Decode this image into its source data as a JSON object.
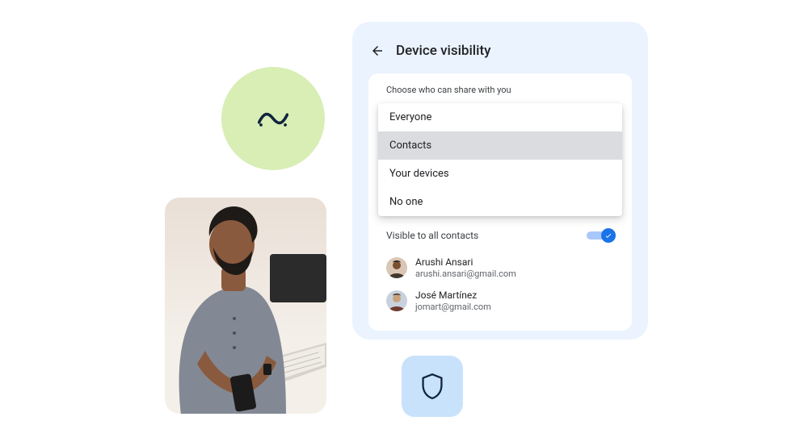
{
  "decor": {
    "wave_icon": "wave-icon",
    "shield_icon": "shield-icon",
    "photo_alt": "person-using-phone"
  },
  "card": {
    "title": "Device visibility",
    "sublabel": "Choose who can share with you",
    "options": [
      {
        "label": "Everyone",
        "selected": false
      },
      {
        "label": "Contacts",
        "selected": true
      },
      {
        "label": "Your devices",
        "selected": false
      },
      {
        "label": "No one",
        "selected": false
      }
    ],
    "visible_row_label": "Visible to all contacts",
    "toggle_on": true,
    "contacts": [
      {
        "name": "Arushi Ansari",
        "email": "arushi.ansari@gmail.com"
      },
      {
        "name": "José Martínez",
        "email": "jomart@gmail.com"
      }
    ]
  }
}
